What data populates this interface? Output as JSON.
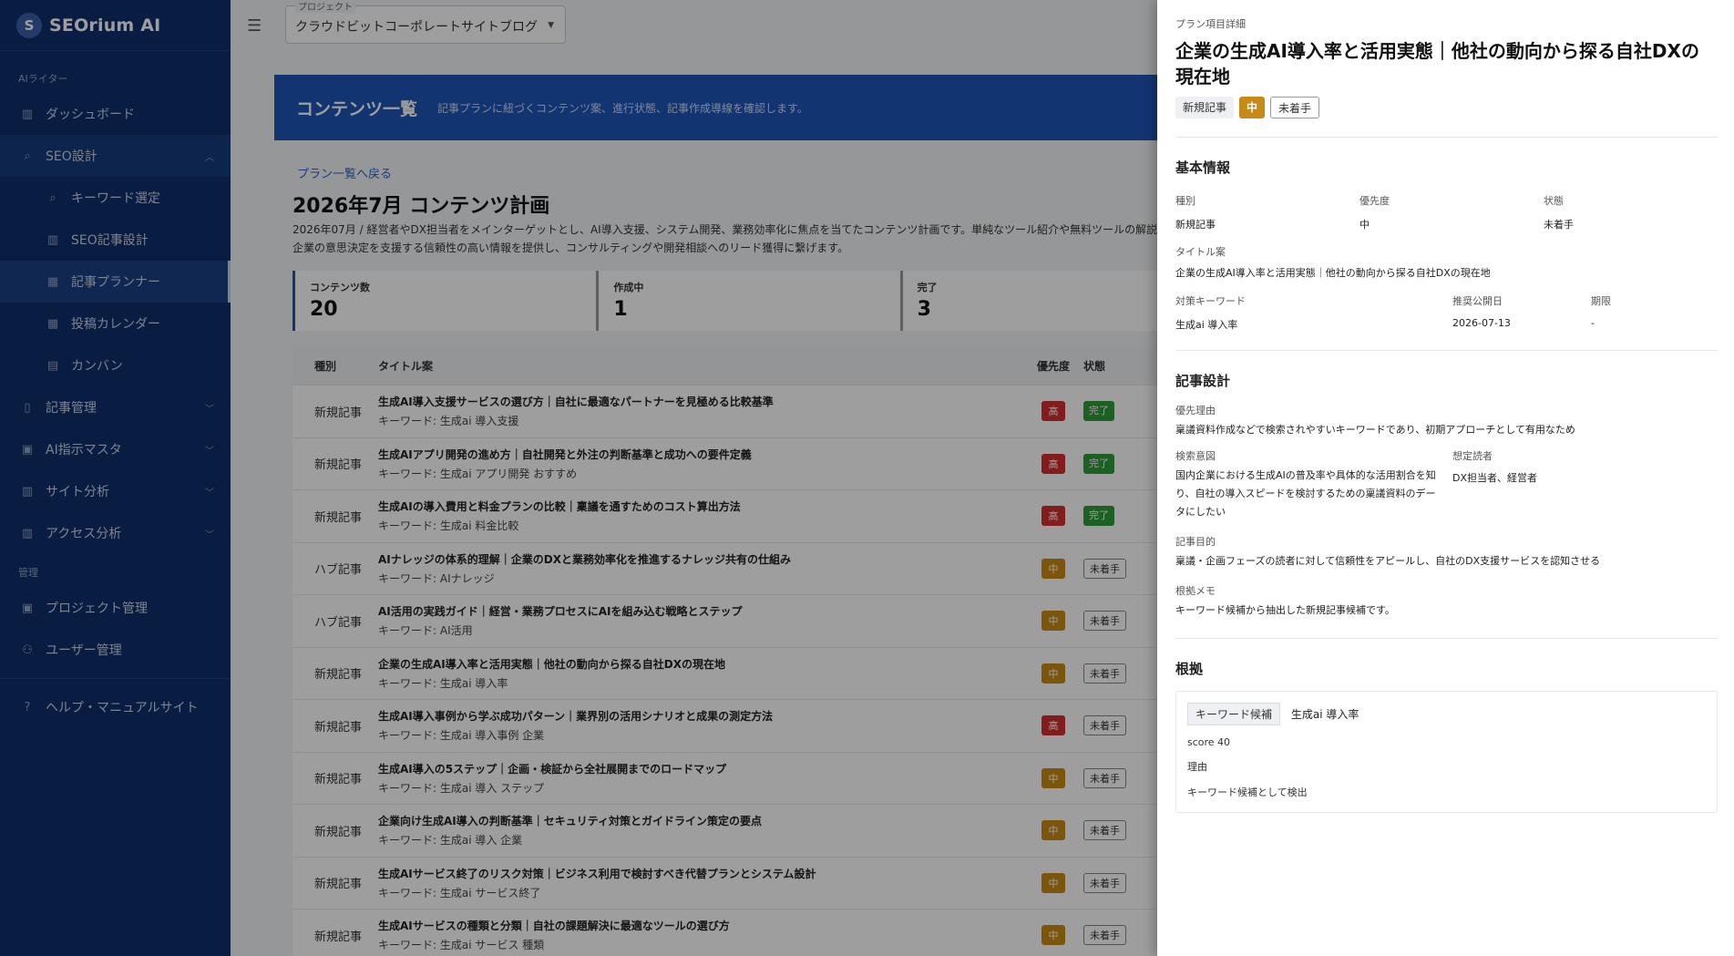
{
  "app": {
    "brand_initial": "S",
    "brand_name": "SEOrium AI"
  },
  "sidebar": {
    "section1": "AIライター",
    "items": [
      {
        "label": "ダッシュボード",
        "icon": "bar-chart-icon"
      },
      {
        "label": "SEO設計",
        "icon": "search-icon"
      },
      {
        "label": "キーワード選定",
        "icon": "search-icon"
      },
      {
        "label": "SEO記事設計",
        "icon": "bar-chart-icon"
      },
      {
        "label": "記事プランナー",
        "icon": "calendar-icon"
      },
      {
        "label": "投稿カレンダー",
        "icon": "calendar-icon"
      },
      {
        "label": "カンバン",
        "icon": "kanban-icon"
      },
      {
        "label": "記事管理",
        "icon": "document-icon"
      },
      {
        "label": "AI指示マスタ",
        "icon": "grid-icon"
      },
      {
        "label": "サイト分析",
        "icon": "bar-chart-icon"
      },
      {
        "label": "アクセス分析",
        "icon": "bar-chart-icon"
      }
    ],
    "section2": "管理",
    "admin_items": [
      {
        "label": "プロジェクト管理",
        "icon": "grid-icon"
      },
      {
        "label": "ユーザー管理",
        "icon": "users-icon"
      }
    ],
    "help": "ヘルプ・マニュアルサイト"
  },
  "topbar": {
    "project_label": "プロジェクト",
    "project_value": "クラウドビットコーポレートサイトブログ"
  },
  "banner": {
    "title": "コンテンツ一覧",
    "subtitle": "記事プランに紐づくコンテンツ案、進行状態、記事作成導線を確認します。"
  },
  "plan": {
    "back_link": "プラン一覧へ戻る",
    "title": "2026年7月 コンテンツ計画",
    "description": "2026年07月 / 経営者やDX担当者をメインターゲットとし、AI導入支援、システム開発、業務効率化に焦点を当てたコンテンツ計画です。単純なツール紹介や無料ツールの解説は避け、企業の意思決定を支援する信頼性の高い情報を提供し、コンサルティングや開発相談へのリード獲得に繋げます。"
  },
  "stats": [
    {
      "label": "コンテンツ数",
      "value": "20"
    },
    {
      "label": "作成中",
      "value": "1"
    },
    {
      "label": "完了",
      "value": "3"
    }
  ],
  "table": {
    "headers": {
      "type": "種別",
      "title": "タイトル案",
      "priority": "優先度",
      "status": "状態"
    },
    "rows": [
      {
        "type": "新規記事",
        "title": "生成AI導入支援サービスの選び方｜自社に最適なパートナーを見極める比較基準",
        "keyword": "キーワード: 生成ai 導入支援",
        "priority": "高",
        "priority_level": "high",
        "status": "完了",
        "status_kind": "done"
      },
      {
        "type": "新規記事",
        "title": "生成AIアプリ開発の進め方｜自社開発と外注の判断基準と成功への要件定義",
        "keyword": "キーワード: 生成ai アプリ開発 おすすめ",
        "priority": "高",
        "priority_level": "high",
        "status": "完了",
        "status_kind": "done"
      },
      {
        "type": "新規記事",
        "title": "生成AIの導入費用と料金プランの比較｜稟議を通すためのコスト算出方法",
        "keyword": "キーワード: 生成ai 料金比較",
        "priority": "高",
        "priority_level": "high",
        "status": "完了",
        "status_kind": "done"
      },
      {
        "type": "ハブ記事",
        "title": "AIナレッジの体系的理解｜企業のDXと業務効率化を推進するナレッジ共有の仕組み",
        "keyword": "キーワード: AIナレッジ",
        "priority": "中",
        "priority_level": "mid",
        "status": "未着手",
        "status_kind": "todo"
      },
      {
        "type": "ハブ記事",
        "title": "AI活用の実践ガイド｜経営・業務プロセスにAIを組み込む戦略とステップ",
        "keyword": "キーワード: AI活用",
        "priority": "中",
        "priority_level": "mid",
        "status": "未着手",
        "status_kind": "todo"
      },
      {
        "type": "新規記事",
        "title": "企業の生成AI導入率と活用実態｜他社の動向から探る自社DXの現在地",
        "keyword": "キーワード: 生成ai 導入率",
        "priority": "中",
        "priority_level": "mid",
        "status": "未着手",
        "status_kind": "todo"
      },
      {
        "type": "新規記事",
        "title": "生成AI導入事例から学ぶ成功パターン｜業界別の活用シナリオと成果の測定方法",
        "keyword": "キーワード: 生成ai 導入事例 企業",
        "priority": "高",
        "priority_level": "high",
        "status": "未着手",
        "status_kind": "todo"
      },
      {
        "type": "新規記事",
        "title": "生成AI導入の5ステップ｜企画・検証から全社展開までのロードマップ",
        "keyword": "キーワード: 生成ai 導入 ステップ",
        "priority": "中",
        "priority_level": "mid",
        "status": "未着手",
        "status_kind": "todo"
      },
      {
        "type": "新規記事",
        "title": "企業向け生成AI導入の判断基準｜セキュリティ対策とガイドライン策定の要点",
        "keyword": "キーワード: 生成ai 導入 企業",
        "priority": "中",
        "priority_level": "mid",
        "status": "未着手",
        "status_kind": "todo"
      },
      {
        "type": "新規記事",
        "title": "生成AIサービス終了のリスク対策｜ビジネス利用で検討すべき代替プランとシステム設計",
        "keyword": "キーワード: 生成ai サービス終了",
        "priority": "中",
        "priority_level": "mid",
        "status": "未着手",
        "status_kind": "todo"
      },
      {
        "type": "新規記事",
        "title": "生成AIサービスの種類と分類｜自社の課題解決に最適なツールの選び方",
        "keyword": "キーワード: 生成ai サービス 種類",
        "priority": "中",
        "priority_level": "mid",
        "status": "未着手",
        "status_kind": "todo"
      }
    ]
  },
  "drawer": {
    "kicker": "プラン項目詳細",
    "title": "企業の生成AI導入率と活用実態｜他社の動向から探る自社DXの現在地",
    "tags": [
      "新規記事",
      "中",
      "未着手"
    ],
    "basic_heading": "基本情報",
    "basic": {
      "type_label": "種別",
      "type_value": "新規記事",
      "priority_label": "優先度",
      "priority_value": "中",
      "status_label": "状態",
      "status_value": "未着手",
      "title_label": "タイトル案",
      "title_value": "企業の生成AI導入率と活用実態｜他社の動向から探る自社DXの現在地",
      "keyword_label": "対策キーワード",
      "keyword_value": "生成ai 導入率",
      "pubdate_label": "推奨公開日",
      "pubdate_value": "2026-07-13",
      "deadline_label": "期限",
      "deadline_value": "-"
    },
    "design_heading": "記事設計",
    "design": {
      "reason_label": "優先理由",
      "reason_value": "稟議資料作成などで検索されやすいキーワードであり、初期アプローチとして有用なため",
      "intent_label": "検索意図",
      "intent_value": "国内企業における生成AIの普及率や具体的な活用割合を知り、自社の導入スピードを検討するための稟議資料のデータにしたい",
      "reader_label": "想定読者",
      "reader_value": "DX担当者、経営者",
      "purpose_label": "記事目的",
      "purpose_value": "稟議・企画フェーズの読者に対して信頼性をアピールし、自社のDX支援サービスを認知させる",
      "memo_label": "根拠メモ",
      "memo_value": "キーワード候補から抽出した新規記事候補です。"
    },
    "evidence_heading": "根拠",
    "evidence": {
      "tag": "キーワード候補",
      "keyword": "生成ai 導入率",
      "score": "score 40",
      "reason_label": "理由",
      "reason_value": "キーワード候補として検出"
    }
  }
}
